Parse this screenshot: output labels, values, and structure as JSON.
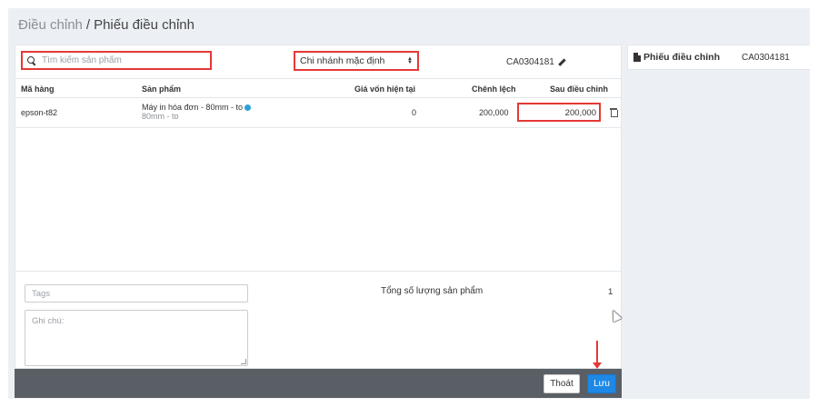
{
  "breadcrumb": {
    "parent": "Điều chỉnh",
    "separator": "/",
    "current": "Phiếu điều chỉnh"
  },
  "search": {
    "placeholder": "Tìm kiếm sản phẩm",
    "value": ""
  },
  "branch_select": {
    "selected": "Chi nhánh mặc định"
  },
  "document_code": "CA0304181",
  "table": {
    "headers": {
      "code": "Mã hàng",
      "product": "Sản phẩm",
      "current_cost": "Giá vốn hiện tại",
      "difference": "Chênh lệch",
      "after_adjust": "Sau điều chỉnh"
    },
    "rows": [
      {
        "code": "epson-t82",
        "product_name": "Máy in hóa đơn - 80mm - to",
        "product_variant": "80mm - to",
        "current_cost": "0",
        "difference": "200,000",
        "after_adjust": "200,000"
      }
    ]
  },
  "tags": {
    "placeholder": "Tags"
  },
  "note": {
    "placeholder": "Ghi chú:"
  },
  "summary": {
    "total_label": "Tổng số lượng sản phẩm",
    "total_value": "1"
  },
  "footer": {
    "exit_label": "Thoát",
    "save_label": "Lưu"
  },
  "side_panel": {
    "title": "Phiếu điều chỉnh",
    "code": "CA0304181"
  },
  "icons": {
    "search": "search-icon",
    "edit": "pencil-icon",
    "info": "info-icon",
    "delete": "trash-icon",
    "document": "document-icon"
  },
  "colors": {
    "highlight_border": "#e53935",
    "primary_button": "#1e88e5",
    "footer_bar": "#5a5f66",
    "page_background": "#ecf0f5",
    "info_icon": "#29a3d6"
  }
}
